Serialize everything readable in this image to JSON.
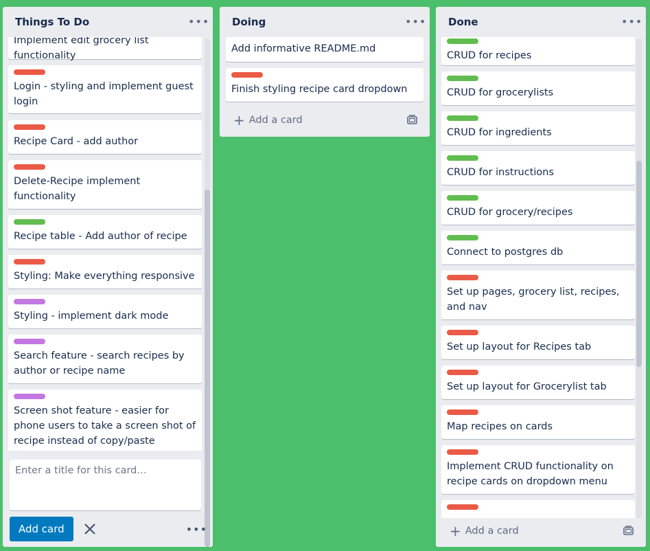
{
  "lists": {
    "todo": {
      "title": "Things To Do",
      "cards": [
        {
          "text": "Implement edit grocery list functionality",
          "label": ""
        },
        {
          "text": "Login - styling and implement guest login",
          "label": "red"
        },
        {
          "text": "Recipe Card - add author",
          "label": "red"
        },
        {
          "text": "Delete-Recipe implement functionality",
          "label": "red"
        },
        {
          "text": "Recipe table - Add author of recipe",
          "label": "green"
        },
        {
          "text": "Styling: Make everything responsive",
          "label": "red"
        },
        {
          "text": "Styling - implement dark mode",
          "label": "purple"
        },
        {
          "text": "Search feature - search recipes by author or recipe name",
          "label": "purple"
        },
        {
          "text": "Screen shot feature - easier for phone users to take a screen shot of recipe instead of copy/paste",
          "label": "purple"
        }
      ],
      "composer": {
        "placeholder": "Enter a title for this card…",
        "add_button": "Add card"
      }
    },
    "doing": {
      "title": "Doing",
      "cards": [
        {
          "text": "Add informative README.md",
          "label": ""
        },
        {
          "text": "Finish styling recipe card dropdown",
          "label": "red"
        }
      ],
      "add_card": "Add a card"
    },
    "done": {
      "title": "Done",
      "cards": [
        {
          "text": "CRUD for recipes",
          "label": "green"
        },
        {
          "text": "CRUD for grocerylists",
          "label": "green"
        },
        {
          "text": "CRUD for ingredients",
          "label": "green"
        },
        {
          "text": "CRUD for instructions",
          "label": "green"
        },
        {
          "text": "CRUD for grocery/recipes",
          "label": "green"
        },
        {
          "text": "Connect to postgres db",
          "label": "green"
        },
        {
          "text": "Set up pages, grocery list, recipes, and nav",
          "label": "red"
        },
        {
          "text": "Set up layout for Recipes tab",
          "label": "red"
        },
        {
          "text": "Set up layout for Grocerylist tab",
          "label": "red"
        },
        {
          "text": "Map recipes on cards",
          "label": "red"
        },
        {
          "text": "Implement CRUD functionality on recipe cards on dropdown menu",
          "label": "red"
        },
        {
          "text": "",
          "label": "red"
        }
      ],
      "add_card": "Add a card"
    }
  },
  "colors": {
    "board_bg": "#4bbf6b",
    "label_red": "#eb5a46",
    "label_green": "#61bd4f",
    "label_purple": "#c377e0",
    "button_blue": "#0079bf"
  },
  "icons": {
    "menu": "more-horizontal-icon",
    "add": "plus-icon",
    "template": "card-template-icon",
    "close": "close-icon"
  }
}
